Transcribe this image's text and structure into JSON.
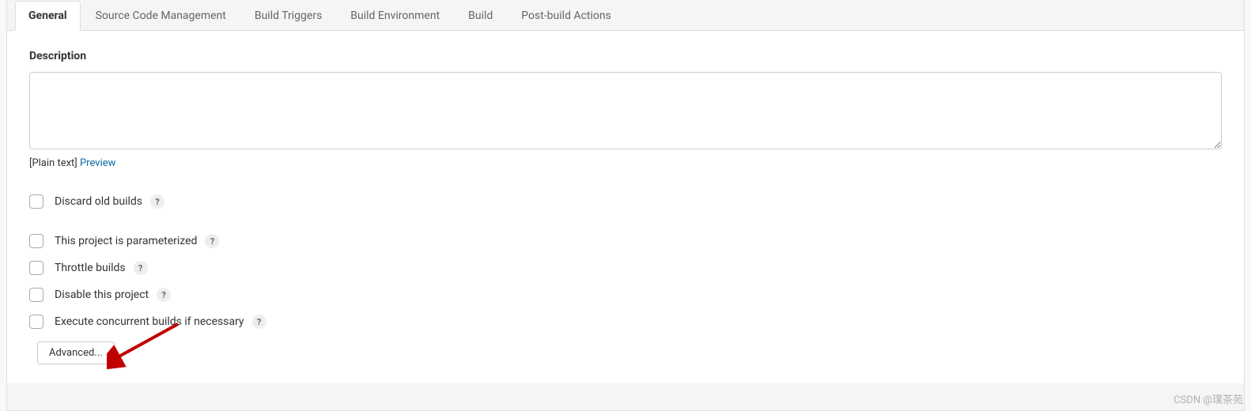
{
  "tabs": [
    {
      "label": "General",
      "active": true
    },
    {
      "label": "Source Code Management",
      "active": false
    },
    {
      "label": "Build Triggers",
      "active": false
    },
    {
      "label": "Build Environment",
      "active": false
    },
    {
      "label": "Build",
      "active": false
    },
    {
      "label": "Post-build Actions",
      "active": false
    }
  ],
  "description": {
    "label": "Description",
    "value": "",
    "plain_text": "[Plain text]",
    "preview_link": "Preview"
  },
  "options": [
    {
      "label": "Discard old builds",
      "checked": false,
      "gap_after": true
    },
    {
      "label": "This project is parameterized",
      "checked": false,
      "gap_after": false
    },
    {
      "label": "Throttle builds",
      "checked": false,
      "gap_after": false
    },
    {
      "label": "Disable this project",
      "checked": false,
      "gap_after": false
    },
    {
      "label": "Execute concurrent builds if necessary",
      "checked": false,
      "gap_after": false
    }
  ],
  "help_glyph": "?",
  "advanced_button": "Advanced...",
  "watermark": "CSDN @璞茶苑"
}
